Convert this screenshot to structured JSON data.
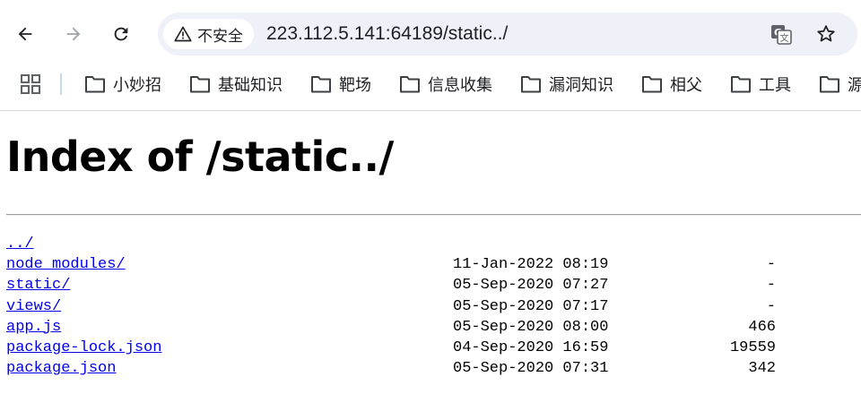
{
  "browser": {
    "nav": {
      "back_icon": "arrow-left-icon",
      "forward_icon": "arrow-right-icon",
      "reload_icon": "reload-icon"
    },
    "omnibox": {
      "security_label": "不安全",
      "security_icon": "warning-triangle-icon",
      "url": "223.112.5.141:64189/static../",
      "translate_icon": "translate-icon",
      "bookmark_icon": "star-icon"
    }
  },
  "bookmarks": {
    "apps_icon": "apps-grid-icon",
    "items": [
      {
        "label": "小妙招"
      },
      {
        "label": "基础知识"
      },
      {
        "label": "靶场"
      },
      {
        "label": "信息收集"
      },
      {
        "label": "漏洞知识"
      },
      {
        "label": "相父"
      },
      {
        "label": "工具"
      },
      {
        "label": "源"
      }
    ]
  },
  "page": {
    "title": "Index of /static../",
    "entries": [
      {
        "name": "../",
        "date": "",
        "size": ""
      },
      {
        "name": "node_modules/",
        "date": "11-Jan-2022 08:19",
        "size": "-"
      },
      {
        "name": "static/",
        "date": "05-Sep-2020 07:27",
        "size": "-"
      },
      {
        "name": "views/",
        "date": "05-Sep-2020 07:17",
        "size": "-"
      },
      {
        "name": "app.js",
        "date": "05-Sep-2020 08:00",
        "size": "466"
      },
      {
        "name": "package-lock.json",
        "date": "04-Sep-2020 16:59",
        "size": "19559"
      },
      {
        "name": "package.json",
        "date": "05-Sep-2020 07:31",
        "size": "342"
      }
    ]
  }
}
